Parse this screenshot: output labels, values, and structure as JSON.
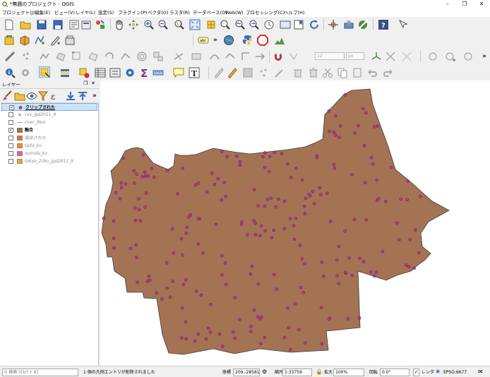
{
  "window": {
    "title": "*無題のプロジェクト - QGIS"
  },
  "menubar": [
    {
      "label": "プロジェクト(J)"
    },
    {
      "label": "編集(E)"
    },
    {
      "label": "ビュー(V)"
    },
    {
      "label": "レイヤ(L)"
    },
    {
      "label": "設定(S)"
    },
    {
      "label": "プラグイン(P)"
    },
    {
      "label": "ベクタ(O)"
    },
    {
      "label": "ラスタ(R)"
    },
    {
      "label": "データベース(D)"
    },
    {
      "label": "Web(W)"
    },
    {
      "label": "プロセッシング(C)"
    },
    {
      "label": "ヘルプ(H)"
    }
  ],
  "toolbar": {
    "label_tool": "abc",
    "font_size": "12",
    "font_unit": "px"
  },
  "layers_panel": {
    "title": "レイヤー",
    "layers": [
      {
        "name": "クリップされた",
        "checked": true,
        "symbol": "point",
        "color": "#b53a8e",
        "selected": true,
        "style": "on"
      },
      {
        "name": "cvs_jgd2011_9",
        "checked": false,
        "symbol": "point",
        "color": "#e3a43a",
        "selected": false,
        "style": "off"
      },
      {
        "name": "river_9kei",
        "checked": false,
        "symbol": "line",
        "color": "#9aa0b8",
        "selected": false,
        "style": "off"
      },
      {
        "name": "融合",
        "checked": true,
        "symbol": "fill",
        "color": "#a47354",
        "selected": false,
        "style": "on"
      },
      {
        "name": "結合された",
        "checked": false,
        "symbol": "fill",
        "color": "#e8731f",
        "selected": false,
        "style": "off"
      },
      {
        "name": "taito_ku",
        "checked": false,
        "symbol": "fill",
        "color": "#f08a24",
        "selected": false,
        "style": "off"
      },
      {
        "name": "sumida_ku",
        "checked": false,
        "symbol": "fill",
        "color": "#e8638c",
        "selected": false,
        "style": "off"
      },
      {
        "name": "tokyo_23ku_jgd2011_9",
        "checked": false,
        "symbol": "fill",
        "color": "#d9b13d",
        "selected": false,
        "style": "off"
      }
    ]
  },
  "map": {
    "polygon_fill": "#a47354",
    "polygon_stroke": "#3d3d3d",
    "point_fill": "#b53a8e",
    "point_stroke": "#5a1a48"
  },
  "statusbar": {
    "search_placeholder": "検索 (Ctrl + K)",
    "message": "1 個の凡例エントリが削除されました",
    "coord_label": "座標",
    "coord_value": "209,-28581",
    "scale_label": "縮尺",
    "scale_value": "1:33756",
    "magnifier_label": "拡大",
    "magnifier_value": "100%",
    "rotation_label": "回転",
    "rotation_value": "0.0°",
    "render_label": "レンダ",
    "crs_label": "EPSG:6677"
  }
}
